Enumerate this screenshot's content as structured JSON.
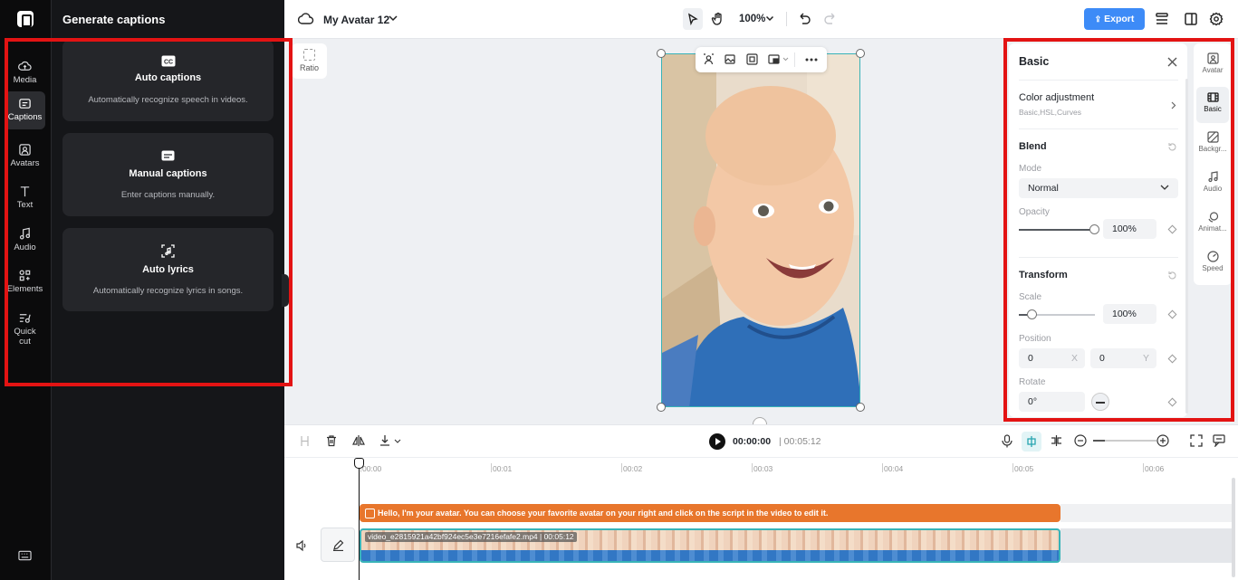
{
  "sidebar": {
    "items": [
      {
        "label": "Media",
        "icon": "cloud-icon"
      },
      {
        "label": "Captions",
        "icon": "captions-icon",
        "active": true
      },
      {
        "label": "Avatars",
        "icon": "avatar-icon"
      },
      {
        "label": "Text",
        "icon": "text-icon"
      },
      {
        "label": "Audio",
        "icon": "music-icon"
      },
      {
        "label": "Elements",
        "icon": "elements-icon"
      },
      {
        "label": "Quick\ncut",
        "icon": "quick-cut-icon"
      }
    ]
  },
  "panel": {
    "title": "Generate captions",
    "cards": [
      {
        "title": "Auto captions",
        "desc": "Automatically recognize speech in videos.",
        "icon": "cc-icon"
      },
      {
        "title": "Manual captions",
        "desc": "Enter captions manually.",
        "icon": "subtitle-icon"
      },
      {
        "title": "Auto lyrics",
        "desc": "Automatically recognize lyrics in songs.",
        "icon": "lyrics-icon"
      }
    ]
  },
  "topbar": {
    "project_name": "My Avatar 12",
    "zoom": "100%",
    "export_label": "Export"
  },
  "canvas": {
    "ratio_label": "Ratio"
  },
  "props": {
    "title": "Basic",
    "color_adjustment": {
      "title": "Color adjustment",
      "subtitle": "Basic,HSL,Curves"
    },
    "blend": {
      "title": "Blend",
      "mode_label": "Mode",
      "mode_value": "Normal",
      "opacity_label": "Opacity",
      "opacity_value": "100%",
      "opacity_level": 1.0
    },
    "transform": {
      "title": "Transform",
      "scale_label": "Scale",
      "scale_value": "100%",
      "scale_level": 0.18,
      "position_label": "Position",
      "pos_x": "0",
      "pos_x_suffix": "X",
      "pos_y": "0",
      "pos_y_suffix": "Y",
      "rotate_label": "Rotate",
      "rotate_value": "0°"
    }
  },
  "right_tabs": [
    {
      "label": "Avatar",
      "icon": "avatar-icon"
    },
    {
      "label": "Basic",
      "icon": "film-icon",
      "active": true
    },
    {
      "label": "Backgr...",
      "icon": "background-icon"
    },
    {
      "label": "Audio",
      "icon": "music-icon"
    },
    {
      "label": "Animat...",
      "icon": "animation-icon"
    },
    {
      "label": "Speed",
      "icon": "speed-icon"
    }
  ],
  "timeline": {
    "current_time": "00:00:00",
    "total_time": "| 00:05:12",
    "ticks": [
      "00:00",
      "00:01",
      "00:02",
      "00:03",
      "00:04",
      "00:05",
      "00:06"
    ],
    "caption_text": "Hello, I'm your avatar. You can choose your favorite avatar on your right and click on the script in the video to edit it.",
    "video_label": "video_e2815921a42bf924ec5e3e7216efafe2.mp4 | 00:05:12"
  },
  "colors": {
    "accent": "#3d8bf7",
    "caption_track": "#e8762c",
    "selection": "#38b3b8",
    "highlight": "#e31313"
  }
}
